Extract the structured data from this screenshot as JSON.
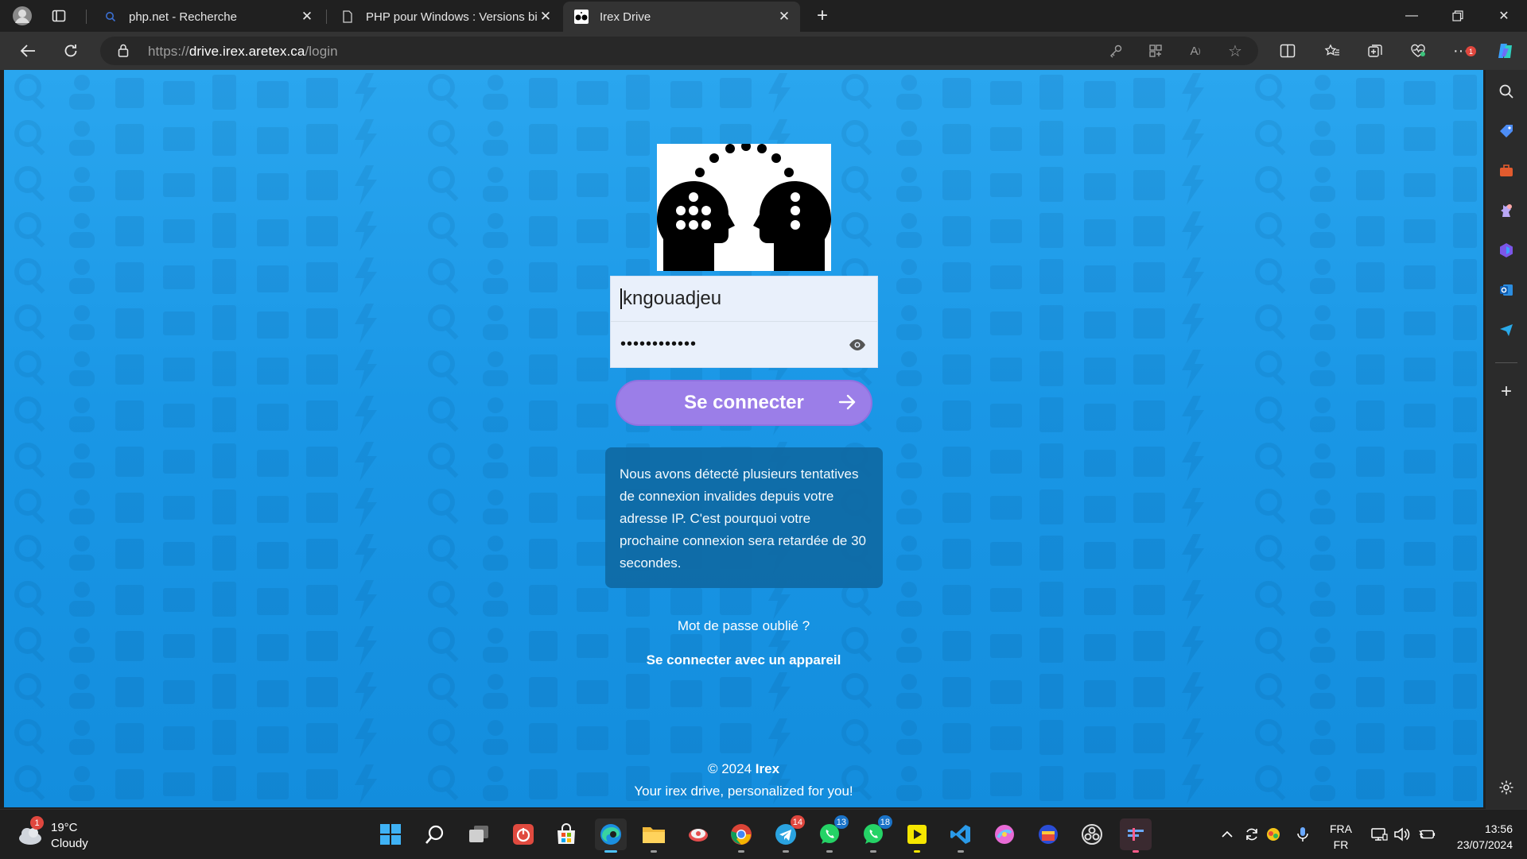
{
  "browser": {
    "tabs": [
      {
        "title": "php.net - Recherche",
        "icon": "search-icon"
      },
      {
        "title": "PHP pour Windows : Versions bin",
        "icon": "document-icon"
      },
      {
        "title": "Irex Drive",
        "icon": "irex-logo-icon"
      }
    ],
    "new_tab_label": "+",
    "url": {
      "scheme": "https://",
      "host": "drive.irex.aretex.ca",
      "path": "/login"
    },
    "window_controls": [
      "minimize",
      "restore",
      "close"
    ],
    "notifications_count": "1"
  },
  "login": {
    "username_value": "kngouadjeu",
    "password_mask": "••••••••••••",
    "submit_label": "Se connecter",
    "warning_text": "Nous avons détecté plusieurs tentatives de connexion invalides depuis votre adresse IP. C'est pourquoi votre prochaine connexion sera retardée de 30 secondes.",
    "forgot_password": "Mot de passe oublié ?",
    "device_login": "Se connecter avec un appareil"
  },
  "footer": {
    "copyright_prefix": "© 2024",
    "brand": "Irex",
    "tagline": "Your irex drive, personalized for you!"
  },
  "taskbar": {
    "weather": {
      "temp": "19°C",
      "condition": "Cloudy",
      "badge": "1"
    },
    "badges": {
      "telegram": "14",
      "whatsapp_1": "13",
      "whatsapp_2": "18"
    },
    "language": {
      "primary": "FRA",
      "secondary": "FR"
    },
    "clock": {
      "time": "13:56",
      "date": "23/07/2024"
    }
  },
  "colors": {
    "page_bg": "#1a97e6",
    "button": "#9b7ee8",
    "warning_bg": "#0f6ba6",
    "browser_chrome": "#202020"
  }
}
